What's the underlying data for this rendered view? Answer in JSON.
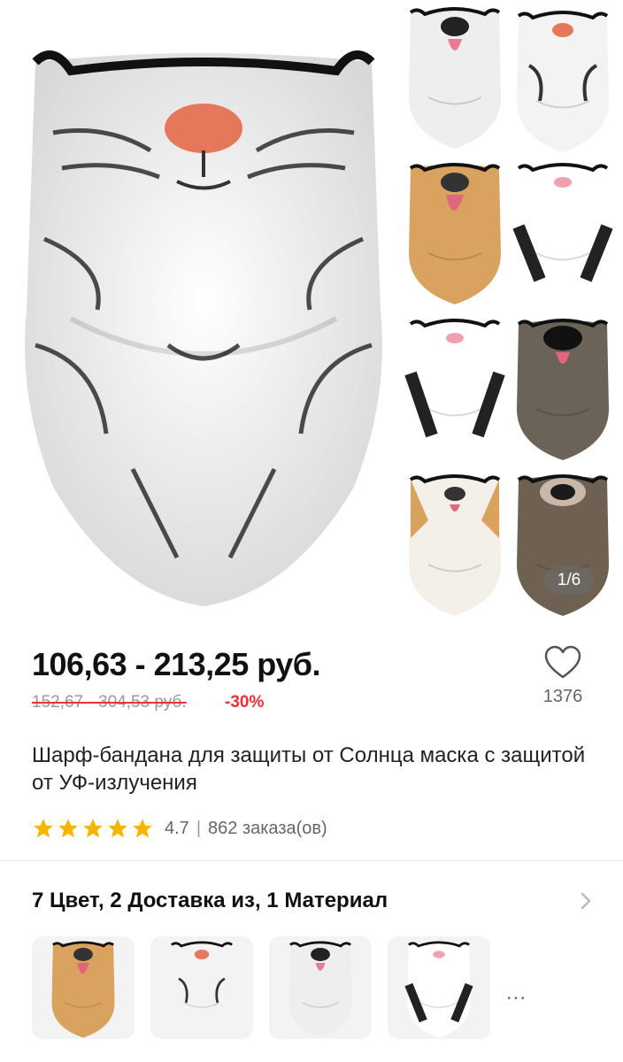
{
  "gallery": {
    "main_image": "tiger-mask-photo",
    "thumbnails": [
      "husky-dog-mask",
      "tiger-cat-mask",
      "golden-retriever-mask",
      "black-white-cat-mask",
      "black-white-cat-mask-2",
      "pug-dog-mask",
      "corgi-dog-mask",
      "sloth-mask"
    ],
    "counter": "1/6"
  },
  "product": {
    "price": "106,63 - 213,25 руб.",
    "old_price": "152,67 - 304,53 руб.",
    "discount": "-30%",
    "favorites_count": "1376",
    "title": "Шарф-бандана для защиты от Солнца маска с защитой от УФ-излучения",
    "rating": "4.7",
    "separator": "|",
    "orders": "862 заказа(ов)",
    "stars_filled": 5
  },
  "options": {
    "title": "7 Цвет, 2 Доставка из, 1 Материал",
    "variants": [
      "golden-retriever-mask",
      "tiger-cat-mask",
      "husky-dog-mask",
      "black-white-cat-mask"
    ],
    "more": "..."
  },
  "colors": {
    "price": "#111111",
    "discount": "#f02d2d",
    "star": "#f7b500",
    "muted": "#999999"
  }
}
